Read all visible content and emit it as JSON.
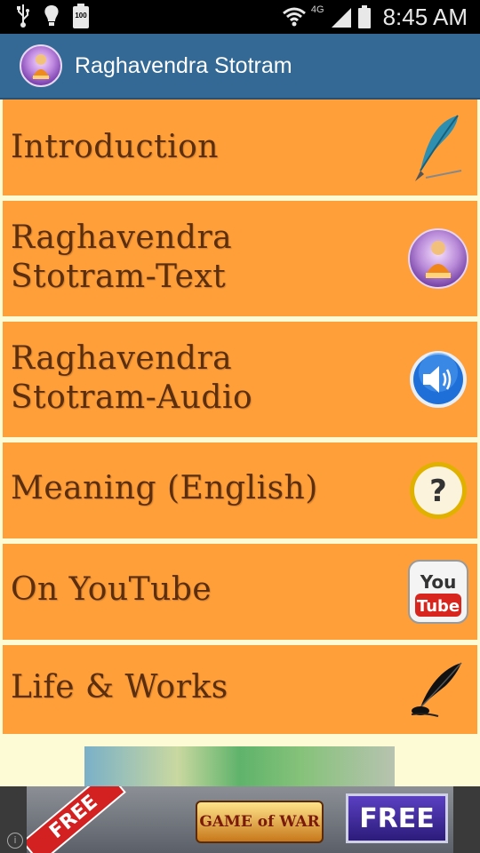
{
  "status_bar": {
    "time": "8:45 AM",
    "battery_level": "100",
    "network_type": "4G"
  },
  "action_bar": {
    "title": "Raghavendra Stotram"
  },
  "menu": {
    "items": [
      {
        "line1": "Introduction",
        "line2": "",
        "icon": "quill-pen-icon"
      },
      {
        "line1": "Raghavendra",
        "line2": "Stotram-Text",
        "icon": "raghavendra-portrait-icon"
      },
      {
        "line1": "Raghavendra",
        "line2": "Stotram-Audio",
        "icon": "speaker-icon"
      },
      {
        "line1": "Meaning (English)",
        "line2": "",
        "icon": "question-mark-icon"
      },
      {
        "line1": "On YouTube",
        "line2": "",
        "icon": "youtube-icon"
      },
      {
        "line1": "Life & Works",
        "line2": "",
        "icon": "feather-inkwell-icon"
      }
    ]
  },
  "ad": {
    "free_left": "FREE",
    "logo": "GAME of WAR",
    "free_right": "FREE",
    "info": "i"
  },
  "colors": {
    "status_bar": "#000000",
    "action_bar": "#336994",
    "menu_item_bg": "#ff9f39",
    "menu_text": "#5a2e0e",
    "page_bg": "#fdfbd6"
  }
}
